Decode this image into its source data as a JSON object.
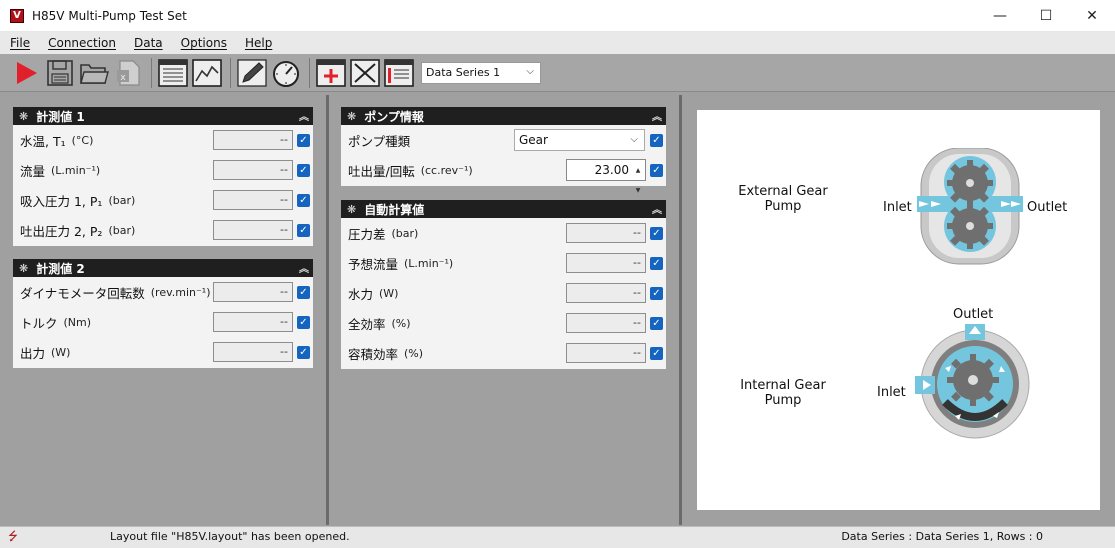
{
  "window": {
    "title": "H85V Multi-Pump Test Set",
    "app_icon_letter": "V",
    "minimize": "—",
    "maximize": "☐",
    "close": "✕"
  },
  "menu": [
    "File",
    "Connection",
    "Data",
    "Options",
    "Help"
  ],
  "toolbar": {
    "data_series_select": "Data Series 1"
  },
  "groups": {
    "measured1": {
      "title": "計測値 1",
      "rows": [
        {
          "label": "水温, T₁",
          "unit": "(°C)",
          "value": "--"
        },
        {
          "label": "流量",
          "unit": "(L.min⁻¹)",
          "value": "--"
        },
        {
          "label": "吸入圧力 1, P₁",
          "unit": "(bar)",
          "value": "--"
        },
        {
          "label": "吐出圧力 2, P₂",
          "unit": "(bar)",
          "value": "--"
        }
      ]
    },
    "measured2": {
      "title": "計測値 2",
      "rows": [
        {
          "label": "ダイナモメータ回転数",
          "unit": "(rev.min⁻¹)",
          "value": "--"
        },
        {
          "label": "トルク",
          "unit": "(Nm)",
          "value": "--"
        },
        {
          "label": "出力",
          "unit": "(W)",
          "value": "--"
        }
      ]
    },
    "pump_info": {
      "title": "ポンプ情報",
      "pump_type_label": "ポンプ種類",
      "pump_type_value": "Gear",
      "displacement_label": "吐出量/回転",
      "displacement_unit": "(cc.rev⁻¹)",
      "displacement_value": "23.00"
    },
    "calculated": {
      "title": "自動計算値",
      "rows": [
        {
          "label": "圧力差",
          "unit": "(bar)",
          "value": "--"
        },
        {
          "label": "予想流量",
          "unit": "(L.min⁻¹)",
          "value": "--"
        },
        {
          "label": "水力",
          "unit": "(W)",
          "value": "--"
        },
        {
          "label": "全効率",
          "unit": "(%)",
          "value": "--"
        },
        {
          "label": "容積効率",
          "unit": "(%)",
          "value": "--"
        }
      ]
    }
  },
  "diagram": {
    "external_title_line1": "External Gear",
    "external_title_line2": "Pump",
    "external_inlet": "Inlet",
    "external_outlet": "Outlet",
    "internal_title_line1": "Internal Gear",
    "internal_title_line2": "Pump",
    "internal_inlet": "Inlet",
    "internal_outlet": "Outlet"
  },
  "status": {
    "message": "Layout file \"H85V.layout\" has been opened.",
    "series_info": "Data Series : Data Series 1,  Rows : 0"
  },
  "colors": {
    "accent_blue": "#1565c0",
    "pump_fluid": "#74c6de",
    "gear_gray": "#6f6f6f",
    "play_red": "#e0202a"
  }
}
